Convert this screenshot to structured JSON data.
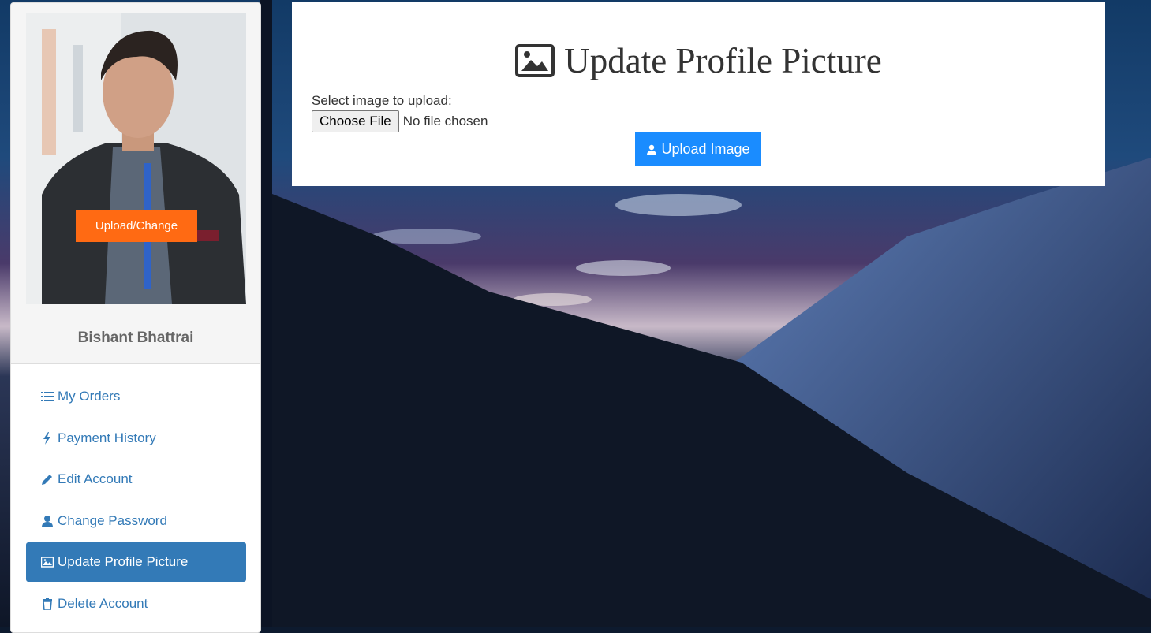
{
  "profile": {
    "upload_change_label": "Upload/Change",
    "user_name": "Bishant Bhattrai"
  },
  "menu": {
    "items": [
      {
        "label": "My Orders",
        "icon": "list-icon"
      },
      {
        "label": "Payment History",
        "icon": "bolt-icon"
      },
      {
        "label": "Edit Account",
        "icon": "pencil-icon"
      },
      {
        "label": "Change Password",
        "icon": "user-icon"
      },
      {
        "label": "Update Profile Picture",
        "icon": "picture-icon",
        "active": true
      },
      {
        "label": "Delete Account",
        "icon": "trash-icon"
      }
    ]
  },
  "panel": {
    "title": "Update Profile Picture",
    "select_label": "Select image to upload:",
    "choose_file_label": "Choose File",
    "no_file_text": "No file chosen",
    "upload_button_label": "Upload Image"
  },
  "colors": {
    "accent": "#337ab7",
    "upload_orange": "#ff6a13",
    "upload_blue": "#1a8cff"
  }
}
